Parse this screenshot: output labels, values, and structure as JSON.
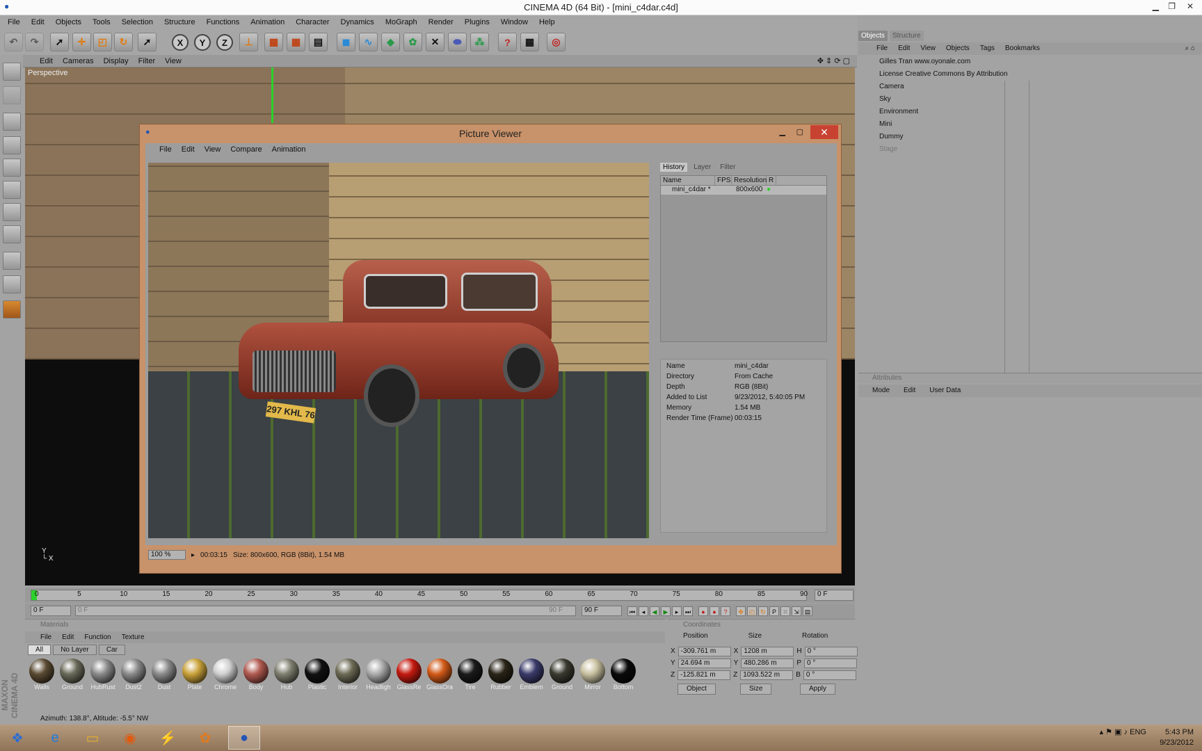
{
  "app": {
    "title": "CINEMA 4D (64 Bit) - [mini_c4dar.c4d]"
  },
  "menu": [
    "File",
    "Edit",
    "Objects",
    "Tools",
    "Selection",
    "Structure",
    "Functions",
    "Animation",
    "Character",
    "Dynamics",
    "MoGraph",
    "Render",
    "Plugins",
    "Window",
    "Help"
  ],
  "toolbar": {
    "axis_x": "X",
    "axis_y": "Y",
    "axis_z": "Z"
  },
  "viewport": {
    "menu": [
      "Edit",
      "Cameras",
      "Display",
      "Filter",
      "View"
    ],
    "label": "Perspective"
  },
  "picture_viewer": {
    "title": "Picture Viewer",
    "menu": [
      "File",
      "Edit",
      "View",
      "Compare",
      "Animation"
    ],
    "tabs": [
      "History",
      "Layer",
      "Filter"
    ],
    "history_headers": [
      "Name",
      "FPS",
      "Resolution",
      "R"
    ],
    "history_rows": [
      {
        "name": "mini_c4dar *",
        "fps": "",
        "resolution": "800x600"
      }
    ],
    "plate_text": "297 KHL 76",
    "info": [
      {
        "k": "Name",
        "v": "mini_c4dar"
      },
      {
        "k": "Directory",
        "v": "From Cache"
      },
      {
        "k": "Depth",
        "v": "RGB (8Bit)"
      },
      {
        "k": "Added to List",
        "v": "9/23/2012, 5:40:05 PM"
      },
      {
        "k": "Memory",
        "v": "1.54 MB"
      },
      {
        "k": "Render Time (Frame)",
        "v": "00:03:15"
      }
    ],
    "status": {
      "zoom": "100 %",
      "time": "00:03:15",
      "size": "Size: 800x600, RGB (8Bit), 1.54 MB"
    }
  },
  "objects": {
    "tabs": [
      "Objects",
      "Structure"
    ],
    "menu": [
      "File",
      "Edit",
      "View",
      "Objects",
      "Tags",
      "Bookmarks"
    ],
    "items": [
      {
        "name": "Gilles Tran www.oyonale.com",
        "dim": false
      },
      {
        "name": "License Creative Commons By Attribution",
        "dim": false
      },
      {
        "name": "Camera",
        "dim": false
      },
      {
        "name": "Sky",
        "dim": false
      },
      {
        "name": "Environment",
        "dim": false
      },
      {
        "name": "Mini",
        "dim": false
      },
      {
        "name": "Dummy",
        "dim": false
      },
      {
        "name": "Stage",
        "dim": true
      }
    ]
  },
  "attributes": {
    "header": "Attributes",
    "menu": [
      "Mode",
      "Edit",
      "User Data"
    ]
  },
  "timeline": {
    "ticks": [
      "0",
      "5",
      "10",
      "15",
      "20",
      "25",
      "30",
      "35",
      "40",
      "45",
      "50",
      "55",
      "60",
      "65",
      "70",
      "75",
      "80",
      "85",
      "90"
    ],
    "end_field": "0 F",
    "start": "0 F",
    "range_start": "0 F",
    "range_end": "90 F",
    "max": "90 F"
  },
  "materials": {
    "header": "Materials",
    "menu": [
      "File",
      "Edit",
      "Function",
      "Texture"
    ],
    "tabs": [
      "All",
      "No Layer",
      "Car"
    ],
    "items": [
      {
        "name": "Walls",
        "color": "#5a4a32"
      },
      {
        "name": "Ground",
        "color": "#6a6a5a"
      },
      {
        "name": "HubRust",
        "color": "#8a8a8a"
      },
      {
        "name": "Dust2",
        "color": "#8a8a8a"
      },
      {
        "name": "Dust",
        "color": "#8a8a8a"
      },
      {
        "name": "Plate",
        "color": "#c9a23a"
      },
      {
        "name": "Chrome",
        "color": "#cfcfcf"
      },
      {
        "name": "Body",
        "color": "#b05a50"
      },
      {
        "name": "Hub",
        "color": "#7f7f70"
      },
      {
        "name": "Plastic",
        "color": "#111111"
      },
      {
        "name": "Interior",
        "color": "#6d6a55"
      },
      {
        "name": "Headligh",
        "color": "#aaaaaa"
      },
      {
        "name": "GlassRe",
        "color": "#c41a10"
      },
      {
        "name": "GlassOra",
        "color": "#d25a18"
      },
      {
        "name": "Tire",
        "color": "#1a1a1a"
      },
      {
        "name": "Rubber",
        "color": "#2a2418"
      },
      {
        "name": "Emblem",
        "color": "#3a3a6a"
      },
      {
        "name": "Ground",
        "color": "#3a3a30"
      },
      {
        "name": "Mirror",
        "color": "#c8c0a0"
      },
      {
        "name": "Bottom",
        "color": "#0a0a0a"
      }
    ]
  },
  "coordinates": {
    "header": "Coordinates",
    "labels": [
      "Position",
      "Size",
      "Rotation"
    ],
    "rows": [
      {
        "a": "X",
        "p": "-309.761 m",
        "b": "X",
        "s": "1208 m",
        "c": "H",
        "r": "0 °"
      },
      {
        "a": "Y",
        "p": "24.694 m",
        "b": "Y",
        "s": "480.286 m",
        "c": "P",
        "r": "0 °"
      },
      {
        "a": "Z",
        "p": "-125.821 m",
        "b": "Z",
        "s": "1093.522 m",
        "c": "B",
        "r": "0 °"
      }
    ],
    "mode": "Object",
    "size_mode": "Size",
    "apply": "Apply"
  },
  "status_text": "Azimuth: 138.8°, Altitude: -5.5° NW",
  "maxon": "MAXON CINEMA 4D",
  "taskbar": {
    "lang": "ENG",
    "time": "5:43 PM",
    "date": "9/23/2012"
  }
}
